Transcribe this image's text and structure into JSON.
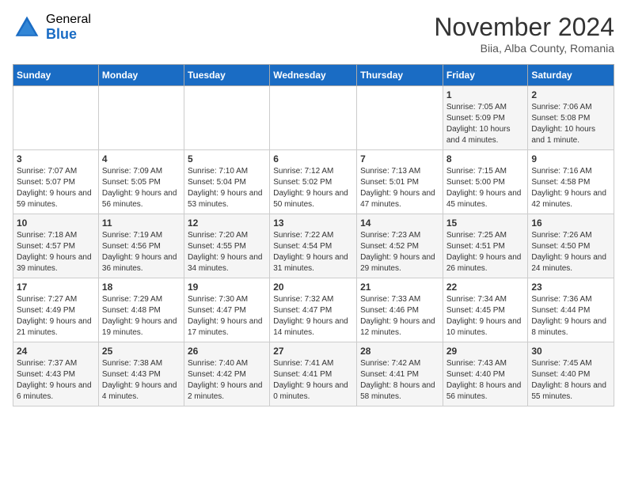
{
  "header": {
    "logo_general": "General",
    "logo_blue": "Blue",
    "month_title": "November 2024",
    "location": "Biia, Alba County, Romania"
  },
  "weekdays": [
    "Sunday",
    "Monday",
    "Tuesday",
    "Wednesday",
    "Thursday",
    "Friday",
    "Saturday"
  ],
  "weeks": [
    [
      {
        "day": "",
        "info": ""
      },
      {
        "day": "",
        "info": ""
      },
      {
        "day": "",
        "info": ""
      },
      {
        "day": "",
        "info": ""
      },
      {
        "day": "",
        "info": ""
      },
      {
        "day": "1",
        "info": "Sunrise: 7:05 AM\nSunset: 5:09 PM\nDaylight: 10 hours and 4 minutes."
      },
      {
        "day": "2",
        "info": "Sunrise: 7:06 AM\nSunset: 5:08 PM\nDaylight: 10 hours and 1 minute."
      }
    ],
    [
      {
        "day": "3",
        "info": "Sunrise: 7:07 AM\nSunset: 5:07 PM\nDaylight: 9 hours and 59 minutes."
      },
      {
        "day": "4",
        "info": "Sunrise: 7:09 AM\nSunset: 5:05 PM\nDaylight: 9 hours and 56 minutes."
      },
      {
        "day": "5",
        "info": "Sunrise: 7:10 AM\nSunset: 5:04 PM\nDaylight: 9 hours and 53 minutes."
      },
      {
        "day": "6",
        "info": "Sunrise: 7:12 AM\nSunset: 5:02 PM\nDaylight: 9 hours and 50 minutes."
      },
      {
        "day": "7",
        "info": "Sunrise: 7:13 AM\nSunset: 5:01 PM\nDaylight: 9 hours and 47 minutes."
      },
      {
        "day": "8",
        "info": "Sunrise: 7:15 AM\nSunset: 5:00 PM\nDaylight: 9 hours and 45 minutes."
      },
      {
        "day": "9",
        "info": "Sunrise: 7:16 AM\nSunset: 4:58 PM\nDaylight: 9 hours and 42 minutes."
      }
    ],
    [
      {
        "day": "10",
        "info": "Sunrise: 7:18 AM\nSunset: 4:57 PM\nDaylight: 9 hours and 39 minutes."
      },
      {
        "day": "11",
        "info": "Sunrise: 7:19 AM\nSunset: 4:56 PM\nDaylight: 9 hours and 36 minutes."
      },
      {
        "day": "12",
        "info": "Sunrise: 7:20 AM\nSunset: 4:55 PM\nDaylight: 9 hours and 34 minutes."
      },
      {
        "day": "13",
        "info": "Sunrise: 7:22 AM\nSunset: 4:54 PM\nDaylight: 9 hours and 31 minutes."
      },
      {
        "day": "14",
        "info": "Sunrise: 7:23 AM\nSunset: 4:52 PM\nDaylight: 9 hours and 29 minutes."
      },
      {
        "day": "15",
        "info": "Sunrise: 7:25 AM\nSunset: 4:51 PM\nDaylight: 9 hours and 26 minutes."
      },
      {
        "day": "16",
        "info": "Sunrise: 7:26 AM\nSunset: 4:50 PM\nDaylight: 9 hours and 24 minutes."
      }
    ],
    [
      {
        "day": "17",
        "info": "Sunrise: 7:27 AM\nSunset: 4:49 PM\nDaylight: 9 hours and 21 minutes."
      },
      {
        "day": "18",
        "info": "Sunrise: 7:29 AM\nSunset: 4:48 PM\nDaylight: 9 hours and 19 minutes."
      },
      {
        "day": "19",
        "info": "Sunrise: 7:30 AM\nSunset: 4:47 PM\nDaylight: 9 hours and 17 minutes."
      },
      {
        "day": "20",
        "info": "Sunrise: 7:32 AM\nSunset: 4:47 PM\nDaylight: 9 hours and 14 minutes."
      },
      {
        "day": "21",
        "info": "Sunrise: 7:33 AM\nSunset: 4:46 PM\nDaylight: 9 hours and 12 minutes."
      },
      {
        "day": "22",
        "info": "Sunrise: 7:34 AM\nSunset: 4:45 PM\nDaylight: 9 hours and 10 minutes."
      },
      {
        "day": "23",
        "info": "Sunrise: 7:36 AM\nSunset: 4:44 PM\nDaylight: 9 hours and 8 minutes."
      }
    ],
    [
      {
        "day": "24",
        "info": "Sunrise: 7:37 AM\nSunset: 4:43 PM\nDaylight: 9 hours and 6 minutes."
      },
      {
        "day": "25",
        "info": "Sunrise: 7:38 AM\nSunset: 4:43 PM\nDaylight: 9 hours and 4 minutes."
      },
      {
        "day": "26",
        "info": "Sunrise: 7:40 AM\nSunset: 4:42 PM\nDaylight: 9 hours and 2 minutes."
      },
      {
        "day": "27",
        "info": "Sunrise: 7:41 AM\nSunset: 4:41 PM\nDaylight: 9 hours and 0 minutes."
      },
      {
        "day": "28",
        "info": "Sunrise: 7:42 AM\nSunset: 4:41 PM\nDaylight: 8 hours and 58 minutes."
      },
      {
        "day": "29",
        "info": "Sunrise: 7:43 AM\nSunset: 4:40 PM\nDaylight: 8 hours and 56 minutes."
      },
      {
        "day": "30",
        "info": "Sunrise: 7:45 AM\nSunset: 4:40 PM\nDaylight: 8 hours and 55 minutes."
      }
    ]
  ]
}
